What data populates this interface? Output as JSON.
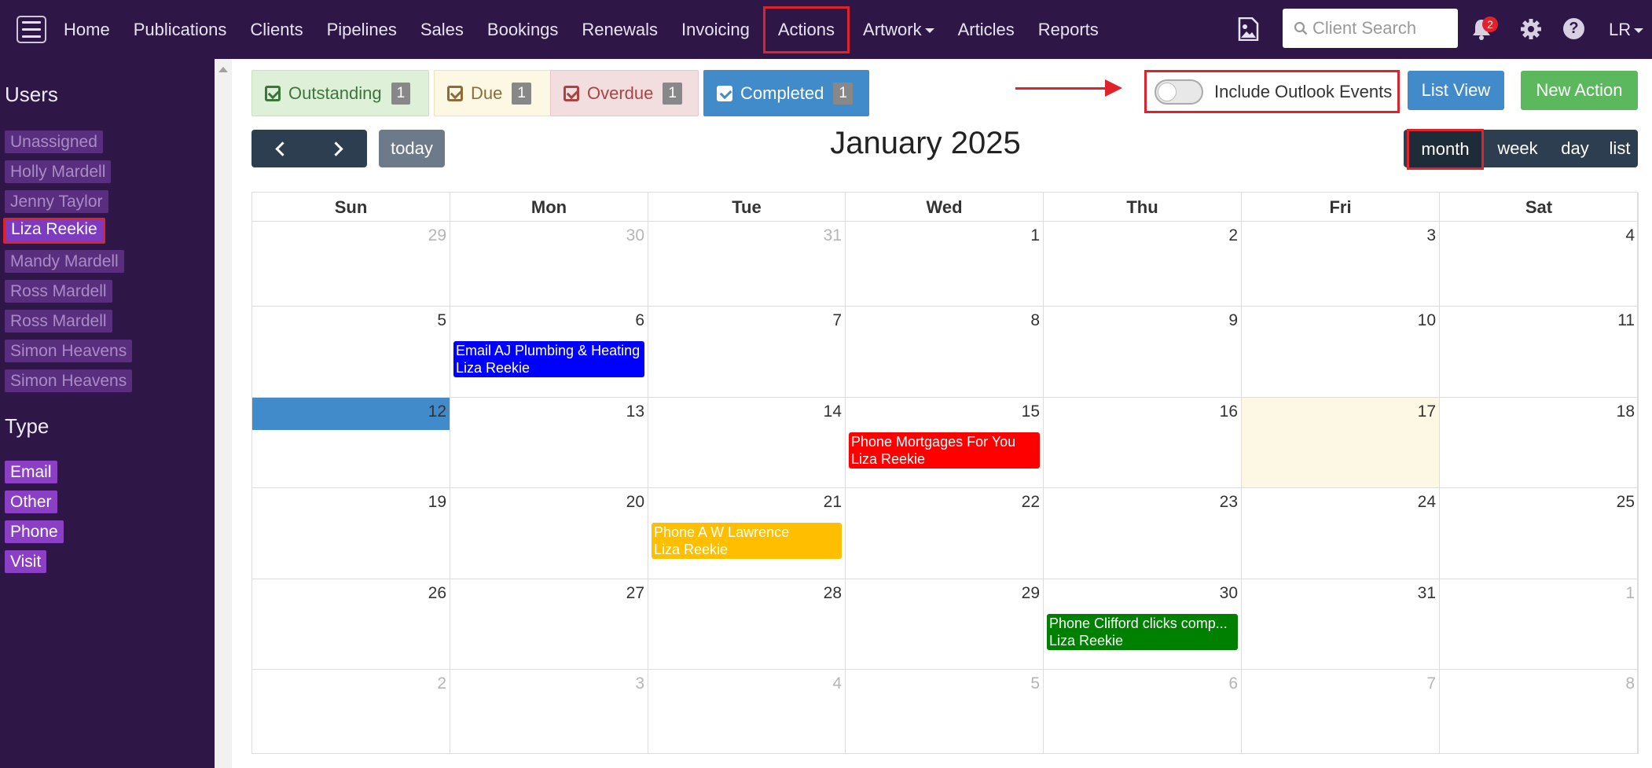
{
  "nav": {
    "items": [
      "Home",
      "Publications",
      "Clients",
      "Pipelines",
      "Sales",
      "Bookings",
      "Renewals",
      "Invoicing",
      "Actions",
      "Artwork",
      "Articles",
      "Reports"
    ],
    "active": "Actions",
    "search_placeholder": "Client Search",
    "notifications": "2",
    "user_initials": "LR"
  },
  "sidebar": {
    "users_heading": "Users",
    "users": [
      "Unassigned",
      "Holly Mardell",
      "Jenny Taylor",
      "Liza Reekie",
      "Mandy Mardell",
      "Ross Mardell",
      "Ross Mardell",
      "Simon Heavens",
      "Simon Heavens"
    ],
    "selected_user": "Liza Reekie",
    "type_heading": "Type",
    "types": [
      "Email",
      "Other",
      "Phone",
      "Visit"
    ]
  },
  "filters": {
    "outstanding": {
      "label": "Outstanding",
      "count": "1"
    },
    "due": {
      "label": "Due",
      "count": "1"
    },
    "overdue": {
      "label": "Overdue",
      "count": "1"
    },
    "completed": {
      "label": "Completed",
      "count": "1"
    }
  },
  "toolbar": {
    "outlook_label": "Include Outlook Events",
    "outlook_enabled": false,
    "list_view": "List View",
    "new_action": "New Action",
    "today": "today",
    "title": "January 2025",
    "views": [
      "month",
      "week",
      "day",
      "list"
    ],
    "active_view": "month"
  },
  "calendar": {
    "weekdays": [
      "Sun",
      "Mon",
      "Tue",
      "Wed",
      "Thu",
      "Fri",
      "Sat"
    ],
    "weeks": [
      [
        {
          "d": "29",
          "o": true
        },
        {
          "d": "30",
          "o": true
        },
        {
          "d": "31",
          "o": true
        },
        {
          "d": "1"
        },
        {
          "d": "2"
        },
        {
          "d": "3"
        },
        {
          "d": "4"
        }
      ],
      [
        {
          "d": "5"
        },
        {
          "d": "6"
        },
        {
          "d": "7"
        },
        {
          "d": "8"
        },
        {
          "d": "9"
        },
        {
          "d": "10"
        },
        {
          "d": "11"
        }
      ],
      [
        {
          "d": "12",
          "selected": true
        },
        {
          "d": "13"
        },
        {
          "d": "14"
        },
        {
          "d": "15"
        },
        {
          "d": "16"
        },
        {
          "d": "17",
          "today": true
        },
        {
          "d": "18"
        }
      ],
      [
        {
          "d": "19"
        },
        {
          "d": "20"
        },
        {
          "d": "21"
        },
        {
          "d": "22"
        },
        {
          "d": "23"
        },
        {
          "d": "24"
        },
        {
          "d": "25"
        }
      ],
      [
        {
          "d": "26"
        },
        {
          "d": "27"
        },
        {
          "d": "28"
        },
        {
          "d": "29"
        },
        {
          "d": "30"
        },
        {
          "d": "31"
        },
        {
          "d": "1",
          "o": true
        }
      ],
      [
        {
          "d": "2",
          "o": true
        },
        {
          "d": "3",
          "o": true
        },
        {
          "d": "4",
          "o": true
        },
        {
          "d": "5",
          "o": true
        },
        {
          "d": "6",
          "o": true
        },
        {
          "d": "7",
          "o": true
        },
        {
          "d": "8",
          "o": true
        }
      ]
    ],
    "events": [
      {
        "week": 1,
        "day": 1,
        "title": "Email AJ Plumbing & Heating",
        "user": "Liza Reekie",
        "color": "#0000ff"
      },
      {
        "week": 2,
        "day": 3,
        "title": "Phone Mortgages For You",
        "user": "Liza Reekie",
        "color": "#ff0000"
      },
      {
        "week": 3,
        "day": 2,
        "title": "Phone A W Lawrence",
        "user": "Liza Reekie",
        "color": "#ffbf00"
      },
      {
        "week": 4,
        "day": 4,
        "title": "Phone Clifford clicks comp...",
        "user": "Liza Reekie",
        "color": "#008000"
      }
    ]
  }
}
